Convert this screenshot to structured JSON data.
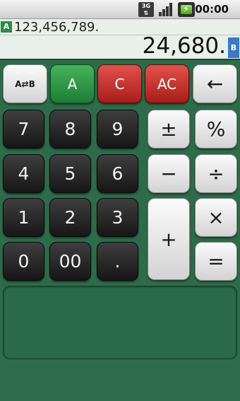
{
  "status": {
    "network": "3G",
    "time": "00:00"
  },
  "display": {
    "memory_a_badge": "A",
    "memory_a_value": "123,456,789.",
    "main_value": "24,680.",
    "memory_b_badge": "B"
  },
  "keys": {
    "swap": "A⇄B",
    "a": "A",
    "c": "C",
    "ac": "AC",
    "backspace": "←",
    "seven": "7",
    "eight": "8",
    "nine": "9",
    "four": "4",
    "five": "5",
    "six": "6",
    "one": "1",
    "two": "2",
    "three": "3",
    "zero": "0",
    "double_zero": "00",
    "dot": ".",
    "plus_minus": "±",
    "percent": "%",
    "minus": "−",
    "divide": "÷",
    "plus": "+",
    "multiply": "×",
    "equals": "="
  },
  "colors": {
    "background": "#2e6b4a",
    "green_key": "#2f9a48",
    "red_key": "#c53a33",
    "badge_a": "#2f8b47",
    "badge_b": "#3c79c7"
  }
}
